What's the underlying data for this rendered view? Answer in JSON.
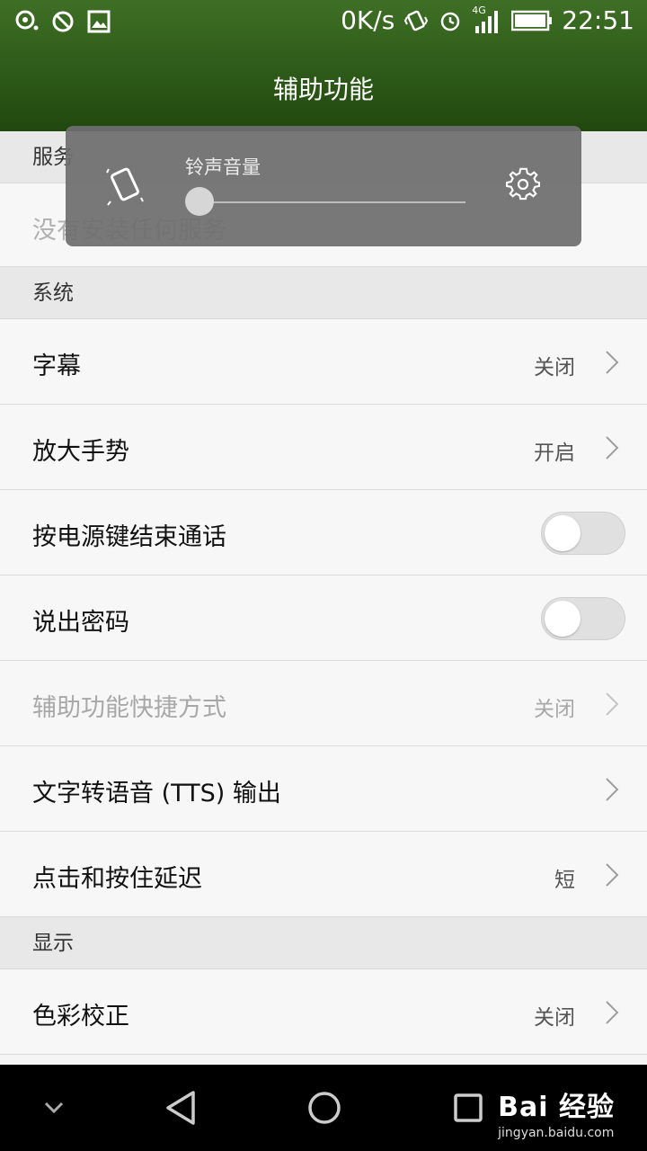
{
  "status_bar": {
    "left_icons": [
      "location-icon",
      "vpn-icon",
      "image-icon"
    ],
    "net_speed": "0K/s",
    "network": "4G",
    "time": "22:51",
    "right_icons": [
      "vibrate-icon",
      "alarm-icon",
      "signal-icon",
      "battery-icon"
    ]
  },
  "header": {
    "title": "辅助功能"
  },
  "volume_overlay": {
    "label": "铃声音量",
    "level": 0,
    "icons": [
      "vibrate-icon",
      "gear-icon"
    ]
  },
  "sections": {
    "services": {
      "header": "服务",
      "empty_text": "没有安装任何服务"
    },
    "system": {
      "header": "系统",
      "items": [
        {
          "label": "字幕",
          "value": "关闭"
        },
        {
          "label": "放大手势",
          "value": "开启"
        },
        {
          "label": "按电源键结束通话",
          "toggle": false
        },
        {
          "label": "说出密码",
          "toggle": false
        },
        {
          "label": "辅助功能快捷方式",
          "value": "关闭",
          "disabled": true
        },
        {
          "label": "文字转语音 (TTS) 输出",
          "value": ""
        },
        {
          "label": "点击和按住延迟",
          "value": "短"
        }
      ]
    },
    "display": {
      "header": "显示",
      "items": [
        {
          "label": "色彩校正",
          "value": "关闭"
        }
      ]
    }
  },
  "nav_bar": {
    "buttons": [
      "down-chevron-icon",
      "back-icon",
      "home-icon",
      "recents-icon"
    ],
    "watermark_main": "Bai 经验",
    "watermark_sub": "jingyan.baidu.com"
  },
  "colors": {
    "header_green": "#2d5a18",
    "list_bg": "#f7f7f7",
    "section_bg": "#e8e8e8",
    "overlay_bg": "#6e6e6e"
  }
}
